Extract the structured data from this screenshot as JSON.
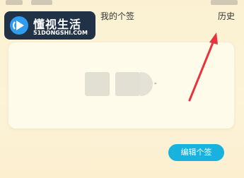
{
  "header": {
    "title": "我的个签",
    "history_label": "历史"
  },
  "watermark": {
    "title": "懂视生活",
    "subtitle": "51DONGSHI.COM"
  },
  "card": {
    "mark": "\""
  },
  "actions": {
    "edit_label": "编辑个签"
  },
  "colors": {
    "background": "#fbf1d4",
    "card": "#fffbea",
    "accent_button": "#17b2dd",
    "annotation_arrow": "#e8333a",
    "watermark_bg": "#223246"
  }
}
